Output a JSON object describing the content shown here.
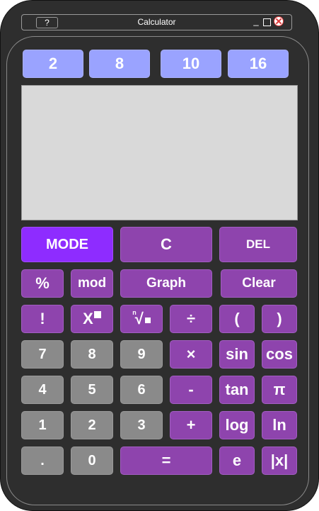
{
  "window": {
    "title": "Calculator",
    "help_label": "?",
    "minimize_label": "_"
  },
  "bases": [
    "2",
    "8",
    "10",
    "16"
  ],
  "display": {
    "value": ""
  },
  "keys": {
    "mode": "MODE",
    "c": "C",
    "del": "DEL",
    "percent": "%",
    "mod": "mod",
    "graph": "Graph",
    "clear": "Clear",
    "factorial": "!",
    "power": "X",
    "root": "√",
    "root_index": "n",
    "divide": "÷",
    "lparen": "(",
    "rparen": ")",
    "seven": "7",
    "eight": "8",
    "nine": "9",
    "multiply": "×",
    "sin": "sin",
    "cos": "cos",
    "four": "4",
    "five": "5",
    "six": "6",
    "minus": "-",
    "tan": "tan",
    "pi": "π",
    "one": "1",
    "two": "2",
    "three": "3",
    "plus": "+",
    "log": "log",
    "ln": "ln",
    "dot": ".",
    "zero": "0",
    "equals": "=",
    "e": "e",
    "abs": "|x|"
  }
}
